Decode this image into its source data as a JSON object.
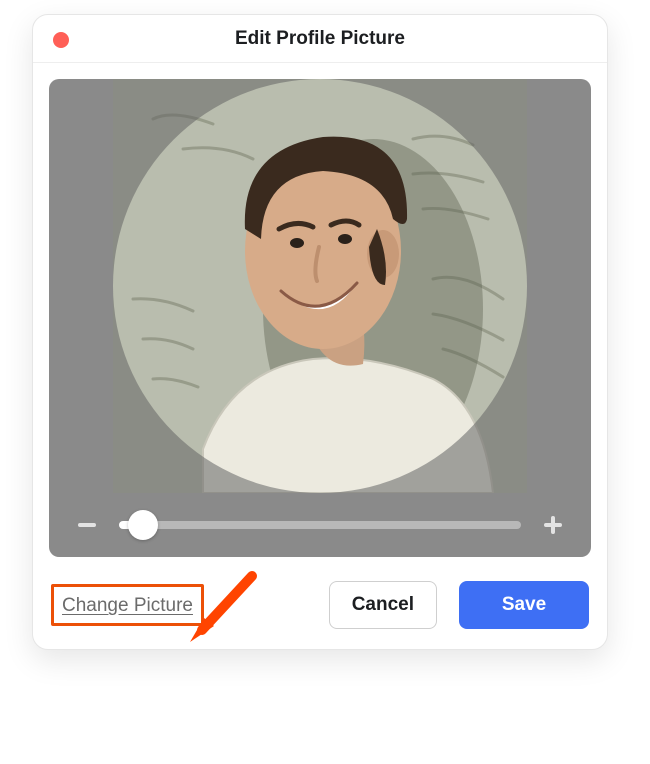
{
  "dialog": {
    "title": "Edit Profile Picture",
    "change_link": "Change Picture",
    "cancel_label": "Cancel",
    "save_label": "Save"
  },
  "zoom": {
    "minus_symbol": "−",
    "plus_symbol": "+",
    "value_percent": 6
  },
  "colors": {
    "close_dot": "#ff5f57",
    "primary": "#3e6ff4",
    "highlight_border": "#ec5007",
    "arrow": "#ff4400"
  }
}
